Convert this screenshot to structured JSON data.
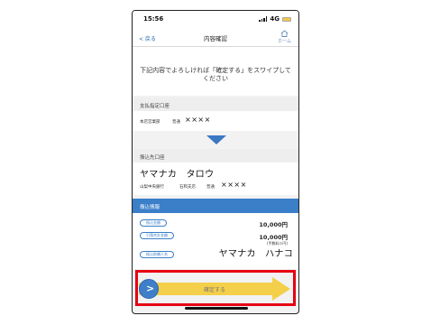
{
  "status_bar": {
    "time": "15:56",
    "network": "4G"
  },
  "nav": {
    "back": "< 戻る",
    "title": "内容確認",
    "home": "ホーム"
  },
  "instruction": "下記内容でよろしければ「確定する」をスワイプしてください",
  "withdrawal": {
    "header": "支払指定口座",
    "branch": "本店営業部",
    "type": "普通",
    "account": "××××"
  },
  "destination": {
    "header": "振込先口座",
    "name": "ヤマナカ　タロウ",
    "bank": "山梨中央銀行",
    "branch": "石和支店",
    "type": "普通",
    "account": "××××"
  },
  "transfer_info": {
    "header": "振込情報",
    "amount_label": "振込金額",
    "amount": "10,000円",
    "total_label": "引落合計金額",
    "total": "10,000円",
    "fee_note": "(手数料０円)",
    "requester_label": "振込依頼人名",
    "requester": "ヤマナカ　ハナコ"
  },
  "confirm": {
    "label": "確定する",
    "knob": ">"
  },
  "colors": {
    "accent_blue": "#3b7fc9",
    "slider_yellow": "#f4cf4a",
    "highlight_red": "#e60012"
  }
}
